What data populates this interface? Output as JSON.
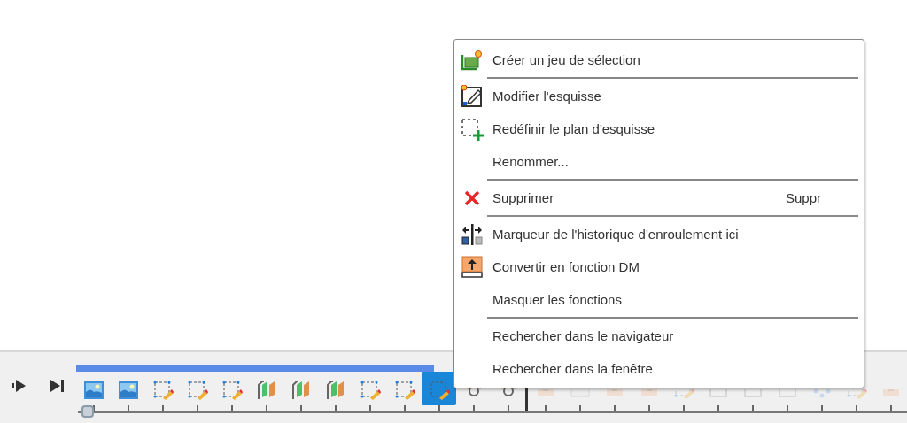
{
  "timeline": {
    "controls": [
      {
        "kind": "step-forward"
      },
      {
        "kind": "go-end"
      }
    ],
    "items": [
      {
        "kind": "image",
        "selected": false,
        "rolled_back": false
      },
      {
        "kind": "image",
        "selected": false,
        "rolled_back": false
      },
      {
        "kind": "sketch",
        "selected": false,
        "rolled_back": false
      },
      {
        "kind": "sketch",
        "selected": false,
        "rolled_back": false
      },
      {
        "kind": "sketch",
        "selected": false,
        "rolled_back": false
      },
      {
        "kind": "extrude",
        "selected": false,
        "rolled_back": false
      },
      {
        "kind": "extrude",
        "selected": false,
        "rolled_back": false
      },
      {
        "kind": "extrude",
        "selected": false,
        "rolled_back": false
      },
      {
        "kind": "sketch",
        "selected": false,
        "rolled_back": false
      },
      {
        "kind": "sketch",
        "selected": false,
        "rolled_back": false
      },
      {
        "kind": "sketch",
        "selected": true,
        "rolled_back": false
      },
      {
        "kind": "joint",
        "selected": false,
        "rolled_back": false
      },
      {
        "kind": "joint",
        "selected": false,
        "rolled_back": false
      },
      {
        "kind": "marker"
      },
      {
        "kind": "box",
        "selected": false,
        "rolled_back": true
      },
      {
        "kind": "plane",
        "selected": false,
        "rolled_back": true
      },
      {
        "kind": "box",
        "selected": false,
        "rolled_back": true
      },
      {
        "kind": "box",
        "selected": false,
        "rolled_back": true
      },
      {
        "kind": "sketch",
        "selected": false,
        "rolled_back": true
      },
      {
        "kind": "frame",
        "selected": false,
        "rolled_back": true
      },
      {
        "kind": "frame",
        "selected": false,
        "rolled_back": true
      },
      {
        "kind": "frame",
        "selected": false,
        "rolled_back": true
      },
      {
        "kind": "points",
        "selected": false,
        "rolled_back": true
      },
      {
        "kind": "sketch",
        "selected": false,
        "rolled_back": true
      },
      {
        "kind": "box",
        "selected": false,
        "rolled_back": true
      }
    ]
  },
  "context_menu": {
    "groups": [
      [
        {
          "kind": "selection-set",
          "label": "Créer un jeu de sélection"
        }
      ],
      [
        {
          "kind": "edit-sketch",
          "label": "Modifier l'esquisse"
        },
        {
          "kind": "redefine-plane",
          "label": "Redéfinir le plan d'esquisse"
        },
        {
          "kind": "plain",
          "label": "Renommer..."
        }
      ],
      [
        {
          "kind": "delete",
          "label": "Supprimer",
          "shortcut": "Suppr"
        }
      ],
      [
        {
          "kind": "rollback",
          "label": "Marqueur de l'historique d'enroulement ici"
        },
        {
          "kind": "convert",
          "label": "Convertir en fonction DM"
        },
        {
          "kind": "plain",
          "label": "Masquer les fonctions"
        }
      ],
      [
        {
          "kind": "plain",
          "label": "Rechercher dans le navigateur"
        },
        {
          "kind": "plain",
          "label": "Rechercher dans la fenêtre"
        }
      ]
    ]
  }
}
